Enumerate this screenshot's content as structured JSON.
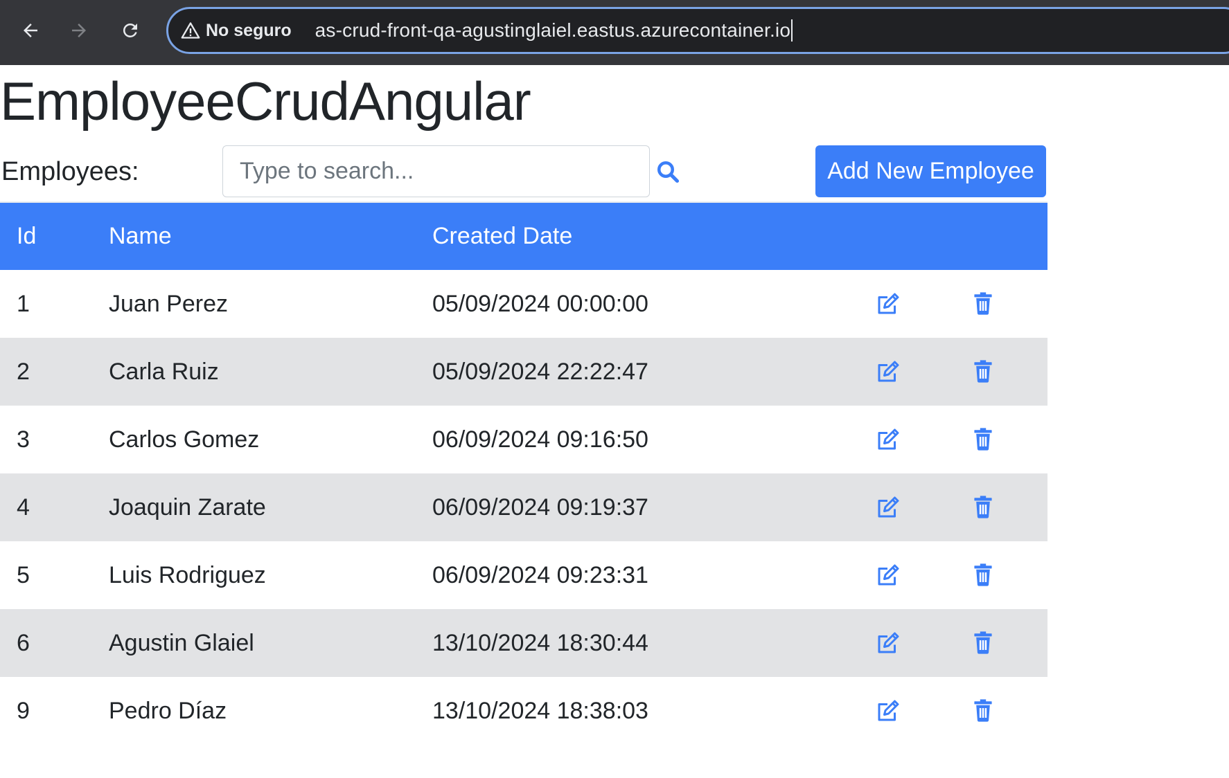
{
  "browser": {
    "security_label": "No seguro",
    "url": "as-crud-front-qa-agustinglaiel.eastus.azurecontainer.io"
  },
  "page": {
    "title": "EmployeeCrudAngular",
    "employees_label": "Employees:",
    "search_placeholder": "Type to search...",
    "add_button_label": "Add New Employee",
    "accent_color": "#3b7ef8",
    "stripe_color": "#e2e3e5"
  },
  "table": {
    "headers": {
      "id": "Id",
      "name": "Name",
      "created": "Created Date"
    },
    "rows": [
      {
        "id": "1",
        "name": "Juan Perez",
        "created": "05/09/2024 00:00:00"
      },
      {
        "id": "2",
        "name": "Carla Ruiz",
        "created": "05/09/2024 22:22:47"
      },
      {
        "id": "3",
        "name": "Carlos Gomez",
        "created": "06/09/2024 09:16:50"
      },
      {
        "id": "4",
        "name": "Joaquin Zarate",
        "created": "06/09/2024 09:19:37"
      },
      {
        "id": "5",
        "name": "Luis Rodriguez",
        "created": "06/09/2024 09:23:31"
      },
      {
        "id": "6",
        "name": "Agustin Glaiel",
        "created": "13/10/2024 18:30:44"
      },
      {
        "id": "9",
        "name": "Pedro Díaz",
        "created": "13/10/2024 18:38:03"
      }
    ],
    "row_actions": [
      "edit-icon",
      "trash-icon"
    ]
  }
}
